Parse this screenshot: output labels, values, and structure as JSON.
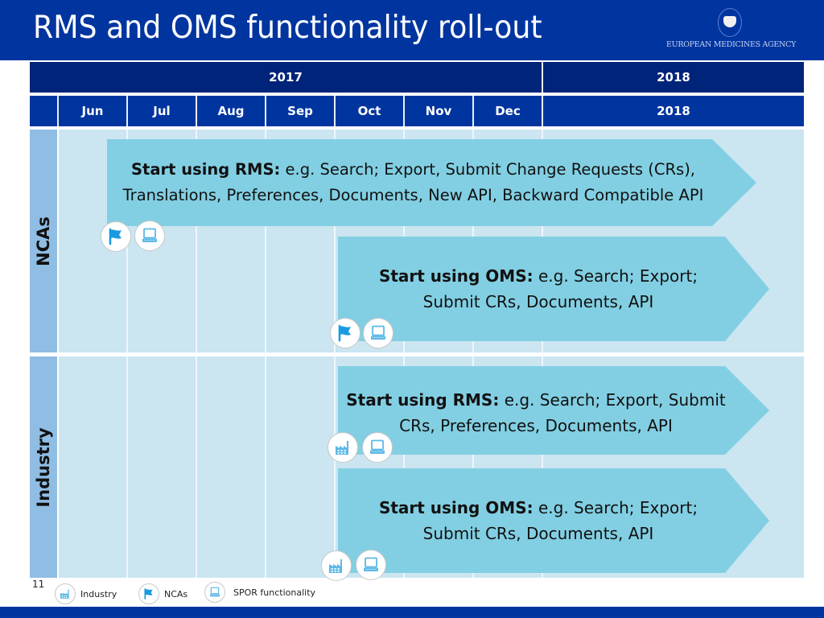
{
  "header": {
    "title": "RMS and OMS functionality roll-out",
    "logo_text": "EUROPEAN MEDICINES AGENCY"
  },
  "timeline": {
    "years": [
      {
        "label": "2017"
      },
      {
        "label": "2018"
      }
    ],
    "months": [
      "Jun",
      "Jul",
      "Aug",
      "Sep",
      "Oct",
      "Nov",
      "Dec",
      "2018"
    ]
  },
  "lanes": [
    {
      "label": "NCAs",
      "items": [
        {
          "title": "Start using RMS:",
          "text": " e.g. Search; Export, Submit Change Requests (CRs), Translations, Preferences, Documents, New API, Backward Compatible API",
          "start": "Jun",
          "icons": [
            "ncas-flag-icon",
            "spor-laptop-icon"
          ]
        },
        {
          "title": "Start using OMS:",
          "text": " e.g. Search; Export; Submit CRs, Documents, API",
          "start": "Oct",
          "icons": [
            "ncas-flag-icon",
            "spor-laptop-icon"
          ]
        }
      ]
    },
    {
      "label": "Industry",
      "items": [
        {
          "title": "Start using RMS:",
          "text": " e.g. Search; Export, Submit CRs, Preferences, Documents, API",
          "start": "Oct",
          "icons": [
            "industry-factory-icon",
            "spor-laptop-icon"
          ]
        },
        {
          "title": "Start using OMS:",
          "text": " e.g. Search; Export; Submit CRs, Documents, API",
          "start": "Oct",
          "icons": [
            "industry-factory-icon",
            "spor-laptop-icon"
          ]
        }
      ]
    }
  ],
  "footer": {
    "page_number": "11",
    "legend": [
      {
        "icon": "factory-icon",
        "label": "Industry"
      },
      {
        "icon": "flag-icon",
        "label": "NCAs"
      },
      {
        "icon": "laptop-icon",
        "label": "SPOR functionality"
      }
    ]
  },
  "colors": {
    "brand_blue": "#0035a0",
    "dark_blue": "#002479",
    "lane_label": "#8fbde4",
    "lane_bg": "#cbe5f1",
    "arrow": "#82cfe3",
    "icon_blue": "#1a9be0",
    "icon_light": "#5cb8e6"
  }
}
